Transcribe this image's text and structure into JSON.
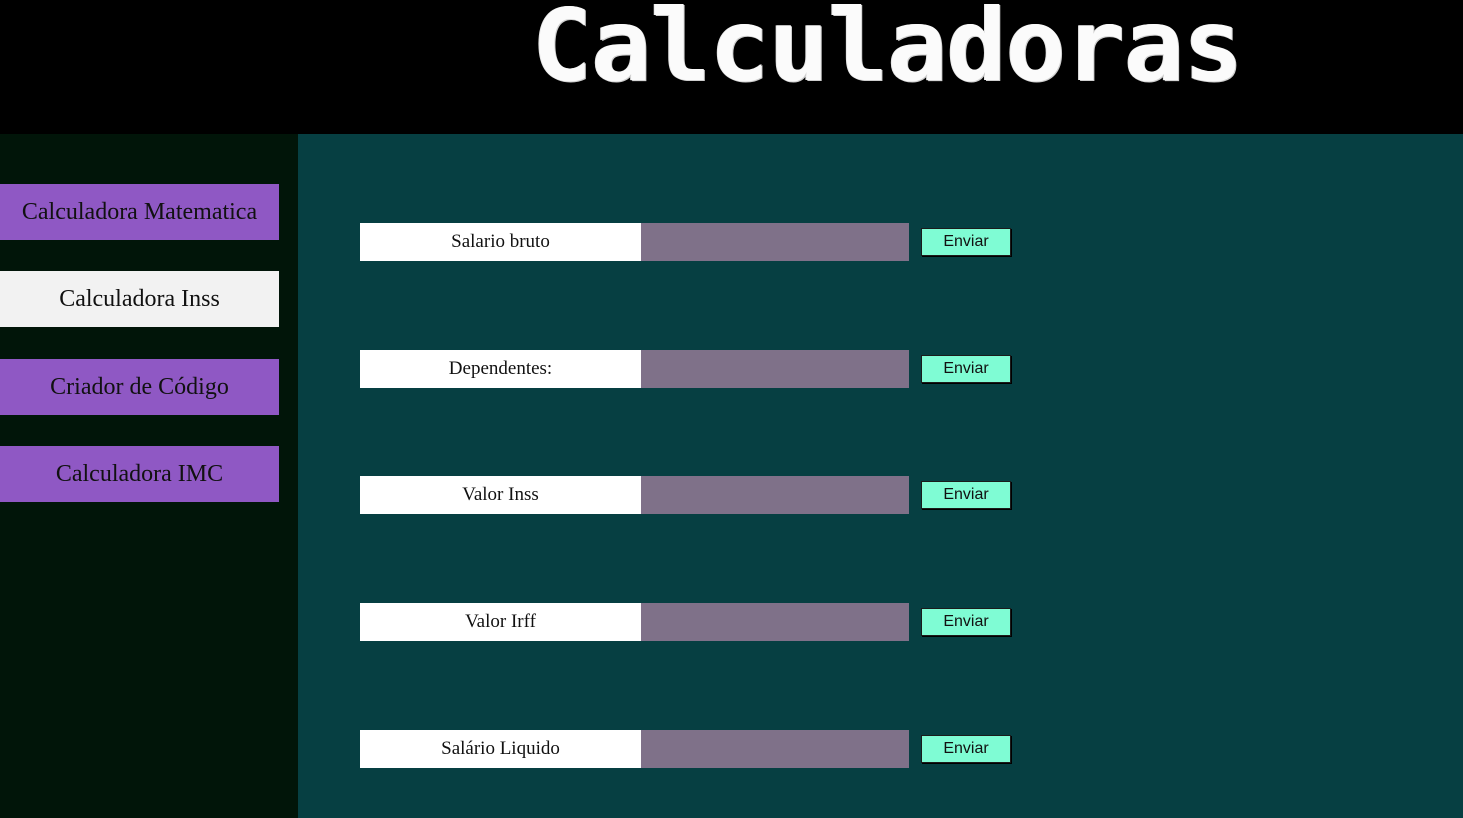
{
  "header": {
    "title": "Calculadoras"
  },
  "sidebar": {
    "items": [
      {
        "label": "Calculadora Matematica",
        "active": false
      },
      {
        "label": "Calculadora Inss",
        "active": true
      },
      {
        "label": "Criador de Código",
        "active": false
      },
      {
        "label": "Calculadora IMC",
        "active": false
      }
    ]
  },
  "form": {
    "rows": [
      {
        "label": "Salario bruto",
        "value": "",
        "button": "Enviar"
      },
      {
        "label": "Dependentes:",
        "value": "",
        "button": "Enviar"
      },
      {
        "label": "Valor Inss",
        "value": "",
        "button": "Enviar"
      },
      {
        "label": "Valor Irff",
        "value": "",
        "button": "Enviar"
      },
      {
        "label": "Salário Liquido",
        "value": "",
        "button": "Enviar"
      }
    ]
  },
  "colors": {
    "header_bg": "#000000",
    "sidebar_bg": "#011509",
    "main_bg": "#063f42",
    "nav_purple": "#8f58c4",
    "nav_active": "#f2f2f2",
    "input_bg": "#7f7189",
    "button_bg": "#7ffcd4"
  }
}
